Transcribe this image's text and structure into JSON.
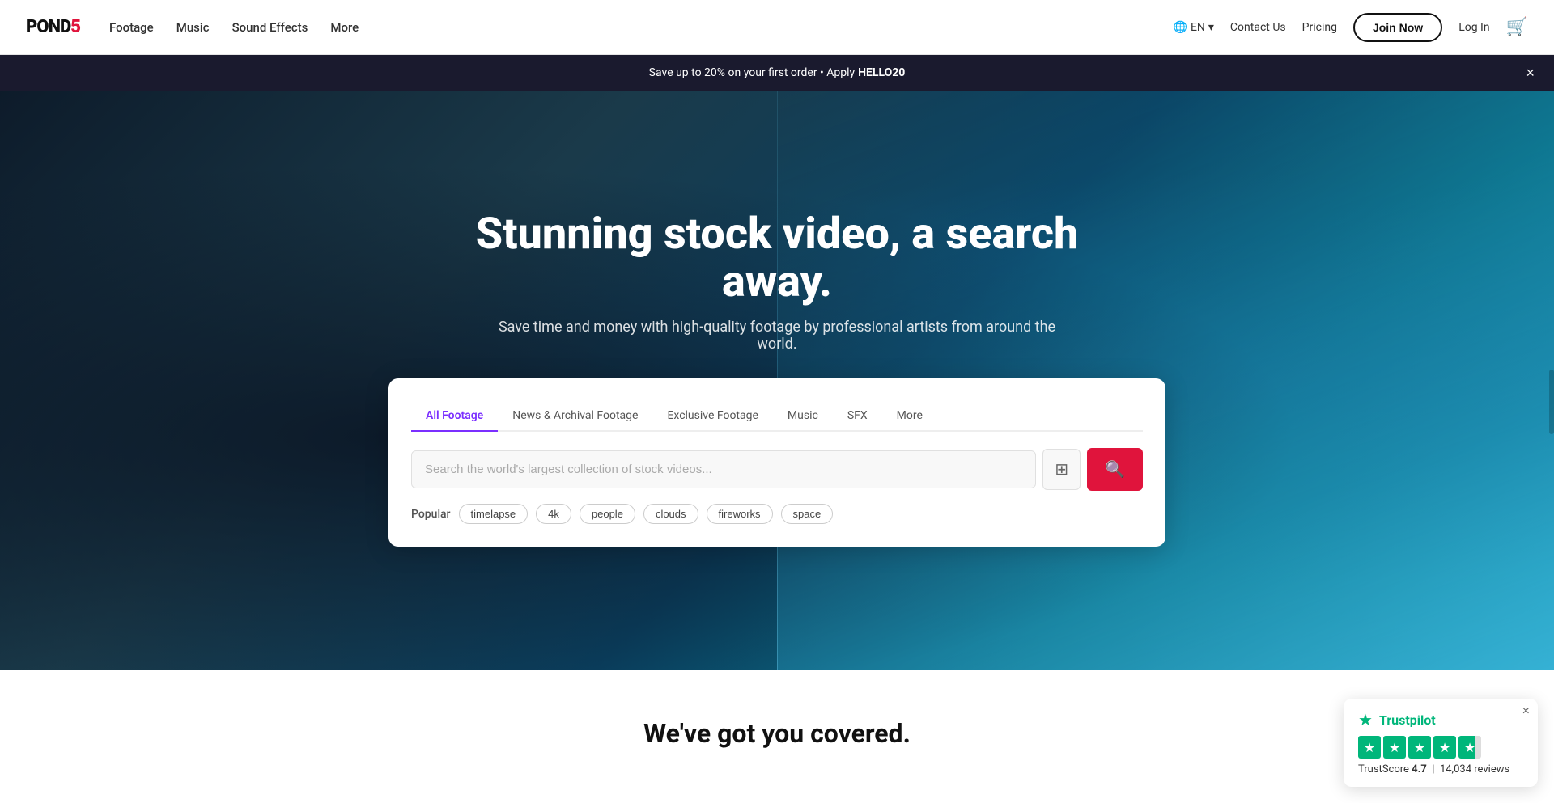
{
  "brand": {
    "name_part1": "POND",
    "name_part2": "5",
    "logo_text": "POND5"
  },
  "nav": {
    "links": [
      {
        "label": "Footage",
        "id": "footage"
      },
      {
        "label": "Music",
        "id": "music"
      },
      {
        "label": "Sound Effects",
        "id": "sound-effects"
      },
      {
        "label": "More",
        "id": "more"
      }
    ],
    "language": "EN",
    "contact_label": "Contact Us",
    "pricing_label": "Pricing",
    "join_label": "Join Now",
    "login_label": "Log In"
  },
  "promo": {
    "text": "Save up to 20% on your first order • Apply",
    "code": "HELLO20",
    "close_label": "×"
  },
  "hero": {
    "title": "Stunning stock video, a search away.",
    "subtitle": "Save time and money with high-quality footage by professional artists from around the world."
  },
  "search": {
    "tabs": [
      {
        "label": "All Footage",
        "active": true
      },
      {
        "label": "News & Archival Footage",
        "active": false
      },
      {
        "label": "Exclusive Footage",
        "active": false
      },
      {
        "label": "Music",
        "active": false
      },
      {
        "label": "SFX",
        "active": false
      },
      {
        "label": "More",
        "active": false
      }
    ],
    "placeholder": "Search the world's largest collection of stock videos...",
    "popular_label": "Popular",
    "popular_tags": [
      "timelapse",
      "4k",
      "people",
      "clouds",
      "fireworks",
      "space"
    ]
  },
  "trustpilot": {
    "brand": "Trustpilot",
    "score_label": "TrustScore",
    "score_value": "4.7",
    "reviews_count": "14,034",
    "reviews_label": "reviews",
    "star_unicode": "★"
  },
  "bottom": {
    "title": "We've got you covered."
  },
  "icons": {
    "cart": "🛒",
    "globe": "🌐",
    "chevron_down": "▾",
    "search": "🔍",
    "visual_search": "⊡",
    "close": "×",
    "star_green": "★",
    "pause": "⏸"
  }
}
